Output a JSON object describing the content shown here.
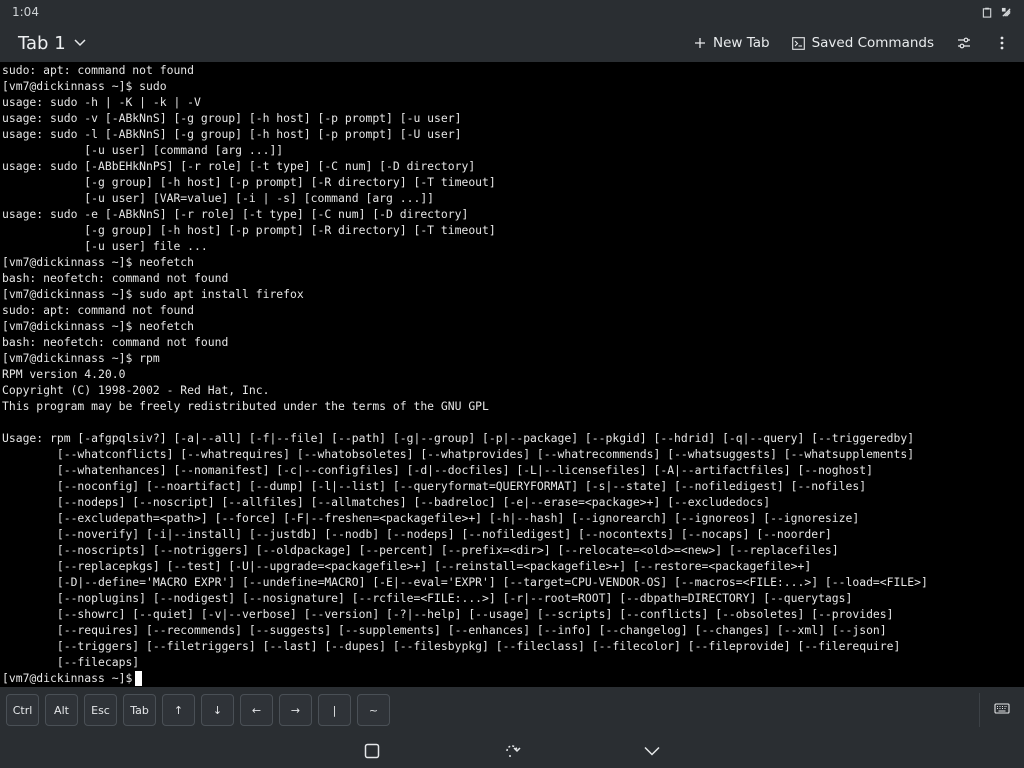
{
  "status": {
    "time": "1:04",
    "icons": [
      "clipboard-icon",
      "connection-icon"
    ]
  },
  "appbar": {
    "tab_title": "Tab 1",
    "new_tab_label": "New Tab",
    "saved_commands_label": "Saved Commands"
  },
  "terminal": {
    "output": "sudo: apt: command not found\n[vm7@dickinnass ~]$ sudo\nusage: sudo -h | -K | -k | -V\nusage: sudo -v [-ABkNnS] [-g group] [-h host] [-p prompt] [-u user]\nusage: sudo -l [-ABkNnS] [-g group] [-h host] [-p prompt] [-U user]\n            [-u user] [command [arg ...]]\nusage: sudo [-ABbEHkNnPS] [-r role] [-t type] [-C num] [-D directory]\n            [-g group] [-h host] [-p prompt] [-R directory] [-T timeout]\n            [-u user] [VAR=value] [-i | -s] [command [arg ...]]\nusage: sudo -e [-ABkNnS] [-r role] [-t type] [-C num] [-D directory]\n            [-g group] [-h host] [-p prompt] [-R directory] [-T timeout]\n            [-u user] file ...\n[vm7@dickinnass ~]$ neofetch\nbash: neofetch: command not found\n[vm7@dickinnass ~]$ sudo apt install firefox\nsudo: apt: command not found\n[vm7@dickinnass ~]$ neofetch\nbash: neofetch: command not found\n[vm7@dickinnass ~]$ rpm\nRPM version 4.20.0\nCopyright (C) 1998-2002 - Red Hat, Inc.\nThis program may be freely redistributed under the terms of the GNU GPL\n\nUsage: rpm [-afgpqlsiv?] [-a|--all] [-f|--file] [--path] [-g|--group] [-p|--package] [--pkgid] [--hdrid] [-q|--query] [--triggeredby]\n        [--whatconflicts] [--whatrequires] [--whatobsoletes] [--whatprovides] [--whatrecommends] [--whatsuggests] [--whatsupplements]\n        [--whatenhances] [--nomanifest] [-c|--configfiles] [-d|--docfiles] [-L|--licensefiles] [-A|--artifactfiles] [--noghost]\n        [--noconfig] [--noartifact] [--dump] [-l|--list] [--queryformat=QUERYFORMAT] [-s|--state] [--nofiledigest] [--nofiles]\n        [--nodeps] [--noscript] [--allfiles] [--allmatches] [--badreloc] [-e|--erase=<package>+] [--excludedocs]\n        [--excludepath=<path>] [--force] [-F|--freshen=<packagefile>+] [-h|--hash] [--ignorearch] [--ignoreos] [--ignoresize]\n        [--noverify] [-i|--install] [--justdb] [--nodb] [--nodeps] [--nofiledigest] [--nocontexts] [--nocaps] [--noorder]\n        [--noscripts] [--notriggers] [--oldpackage] [--percent] [--prefix=<dir>] [--relocate=<old>=<new>] [--replacefiles]\n        [--replacepkgs] [--test] [-U|--upgrade=<packagefile>+] [--reinstall=<packagefile>+] [--restore=<packagefile>+]\n        [-D|--define='MACRO EXPR'] [--undefine=MACRO] [-E|--eval='EXPR'] [--target=CPU-VENDOR-OS] [--macros=<FILE:...>] [--load=<FILE>]\n        [--noplugins] [--nodigest] [--nosignature] [--rcfile=<FILE:...>] [-r|--root=ROOT] [--dbpath=DIRECTORY] [--querytags]\n        [--showrc] [--quiet] [-v|--verbose] [--version] [-?|--help] [--usage] [--scripts] [--conflicts] [--obsoletes] [--provides]\n        [--requires] [--recommends] [--suggests] [--supplements] [--enhances] [--info] [--changelog] [--changes] [--xml] [--json]\n        [--triggers] [--filetriggers] [--last] [--dupes] [--filesbypkg] [--fileclass] [--filecolor] [--fileprovide] [--filerequire]\n        [--filecaps]",
    "prompt": "[vm7@dickinnass ~]$"
  },
  "keybar": {
    "keys": [
      {
        "label": "Ctrl"
      },
      {
        "label": "Alt"
      },
      {
        "label": "Esc"
      },
      {
        "label": "Tab"
      },
      {
        "label": "↑"
      },
      {
        "label": "↓"
      },
      {
        "label": "←"
      },
      {
        "label": "→"
      },
      {
        "label": "|"
      },
      {
        "label": "~"
      }
    ]
  },
  "navbar": {
    "icons": [
      "overview-icon",
      "rotate-icon",
      "hide-keyboard-icon"
    ]
  },
  "colors": {
    "chrome": "#2a2e32",
    "terminal_bg": "#000000",
    "terminal_fg": "#e6e6e6"
  }
}
